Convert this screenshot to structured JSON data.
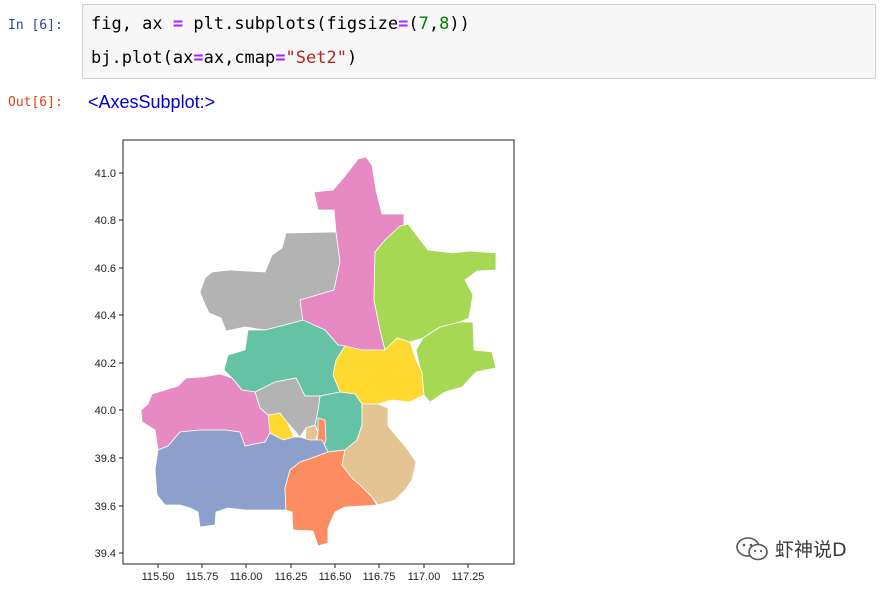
{
  "cell": {
    "in_prompt": "In [6]:",
    "out_prompt": "Out[6]:",
    "code": {
      "line1": {
        "a": "fig, ax ",
        "b": "=",
        "c": " plt.subplots(figsize",
        "d": "=",
        "e": "(",
        "f": "7",
        "g": ",",
        "h": "8",
        "i": "))"
      },
      "line2": {
        "a": "bj.plot(ax",
        "b": "=",
        "c": "ax,cmap",
        "d": "=",
        "e": "\"Set2\"",
        "f": ")"
      }
    },
    "output_text": "<AxesSubplot:>"
  },
  "chart_data": {
    "type": "map",
    "xticks": [
      "115.50",
      "115.75",
      "116.00",
      "116.25",
      "116.50",
      "116.75",
      "117.00",
      "117.25"
    ],
    "yticks": [
      "41.0",
      "40.8",
      "40.6",
      "40.4",
      "40.2",
      "40.0",
      "39.8",
      "39.6",
      "39.4"
    ],
    "colormap": "Set2",
    "colors": [
      "#66c2a5",
      "#fc8d62",
      "#8da0cb",
      "#e78ac3",
      "#a6d854",
      "#ffd92f",
      "#e5c494",
      "#b3b3b3"
    ]
  },
  "watermark": {
    "text": "虾神说D"
  }
}
